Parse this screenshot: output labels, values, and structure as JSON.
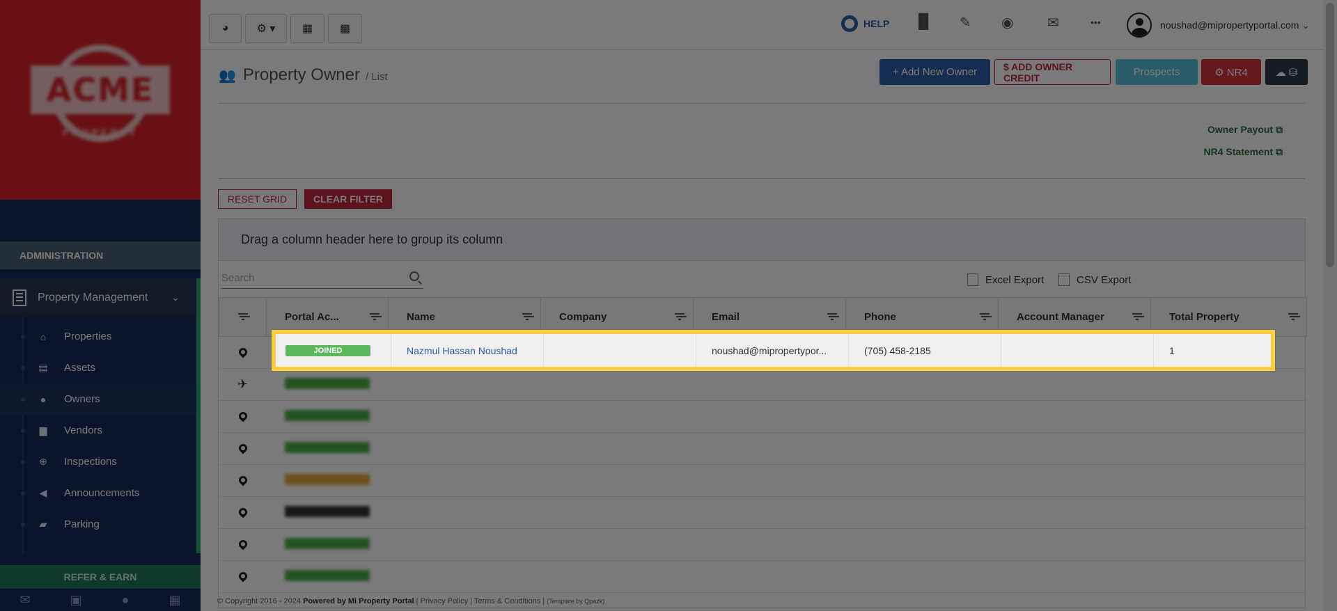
{
  "sidebar": {
    "logo_text": "ACME",
    "logo_subtext": "PROPERTY",
    "section_header": "ADMINISTRATION",
    "group_label": "Property Management",
    "items": [
      {
        "label": "Properties",
        "icon": "home-icon",
        "glyph": "⌂"
      },
      {
        "label": "Assets",
        "icon": "archive-icon",
        "glyph": "▤"
      },
      {
        "label": "Owners",
        "icon": "user-icon",
        "glyph": "●"
      },
      {
        "label": "Vendors",
        "icon": "briefcase-icon",
        "glyph": "▆"
      },
      {
        "label": "Inspections",
        "icon": "search-plus-icon",
        "glyph": "⊕"
      },
      {
        "label": "Announcements",
        "icon": "bullhorn-icon",
        "glyph": "◀"
      },
      {
        "label": "Parking",
        "icon": "car-icon",
        "glyph": "▰"
      }
    ],
    "refer_label": "REFER & EARN",
    "bottom_icons": [
      "✉",
      "▣",
      "●",
      "▦"
    ]
  },
  "topbar": {
    "buttons": [
      {
        "icon": "dashboard-icon",
        "glyph": "◕"
      },
      {
        "icon": "gear-dropdown-icon",
        "glyph": "⚙ ▾"
      },
      {
        "icon": "calendar-icon",
        "glyph": "▦"
      },
      {
        "icon": "calculator-icon",
        "glyph": "▩"
      }
    ],
    "help_label": "HELP",
    "icons": [
      {
        "name": "chart-icon",
        "glyph": "▐▌"
      },
      {
        "name": "wrench-icon",
        "glyph": "✎"
      },
      {
        "name": "eye-icon",
        "glyph": "◉"
      },
      {
        "name": "mail-icon",
        "glyph": "✉"
      },
      {
        "name": "more-icon",
        "glyph": "•••"
      }
    ],
    "user_email": "noushad@mipropertyportal.com",
    "user_chevron": "⌄"
  },
  "page": {
    "title": "Property Owner",
    "subtitle": "/ List",
    "actions": [
      {
        "label": "+ Add New Owner",
        "color": "#2a5ea8"
      },
      {
        "label": "$ ADD OWNER CREDIT",
        "color": "#c5263f"
      },
      {
        "label": "Prospects",
        "color": "#5bc0de"
      },
      {
        "label": "⚙ NR4",
        "color": "#d9363e"
      },
      {
        "label": "☁ ⛁",
        "color": "#2f3b4a"
      }
    ],
    "links": [
      {
        "label": "Owner Payout ⧉"
      },
      {
        "label": "NR4 Statement ⧉"
      }
    ],
    "reset_grid": "RESET GRID",
    "clear_filter": "CLEAR FILTER"
  },
  "grid": {
    "group_hint": "Drag a column header here to group its column",
    "search_placeholder": "Search",
    "excel_export": "Excel Export",
    "csv_export": "CSV Export",
    "columns": [
      "Portal Ac...",
      "Name",
      "Company",
      "Email",
      "Phone",
      "Account Manager",
      "Total Property"
    ],
    "highlighted_row": {
      "status": "JOINED",
      "status_color": "#5cb85c",
      "name": "Nazmul Hassan Noushad",
      "company": "",
      "email": "noushad@mipropertypor...",
      "phone": "(705) 458-2185",
      "account_manager": "",
      "total_property": "1"
    },
    "rows": [
      {
        "marker": "plane",
        "status_color": "#4cae4c"
      },
      {
        "marker": "pin",
        "status_color": "#4cae4c"
      },
      {
        "marker": "pin",
        "status_color": "#4cae4c"
      },
      {
        "marker": "pin",
        "status_color": "#e5a93b"
      },
      {
        "marker": "pin",
        "status_color": "#333333"
      },
      {
        "marker": "pin",
        "status_color": "#4cae4c"
      },
      {
        "marker": "pin",
        "status_color": "#4cae4c"
      }
    ]
  },
  "footer": {
    "copyright": "© Copyright 2016 - 2024",
    "powered": "Powered by Mi Property Portal",
    "privacy": "Privacy Policy",
    "terms": "Terms & Conditions",
    "template": "(Template by Qpazk)"
  },
  "colors": {
    "overlay": "rgba(0,0,0,0.52)",
    "highlight": "#f8d03f",
    "accent_green": "#24a86b",
    "sidebar": "#1a2b5e"
  }
}
